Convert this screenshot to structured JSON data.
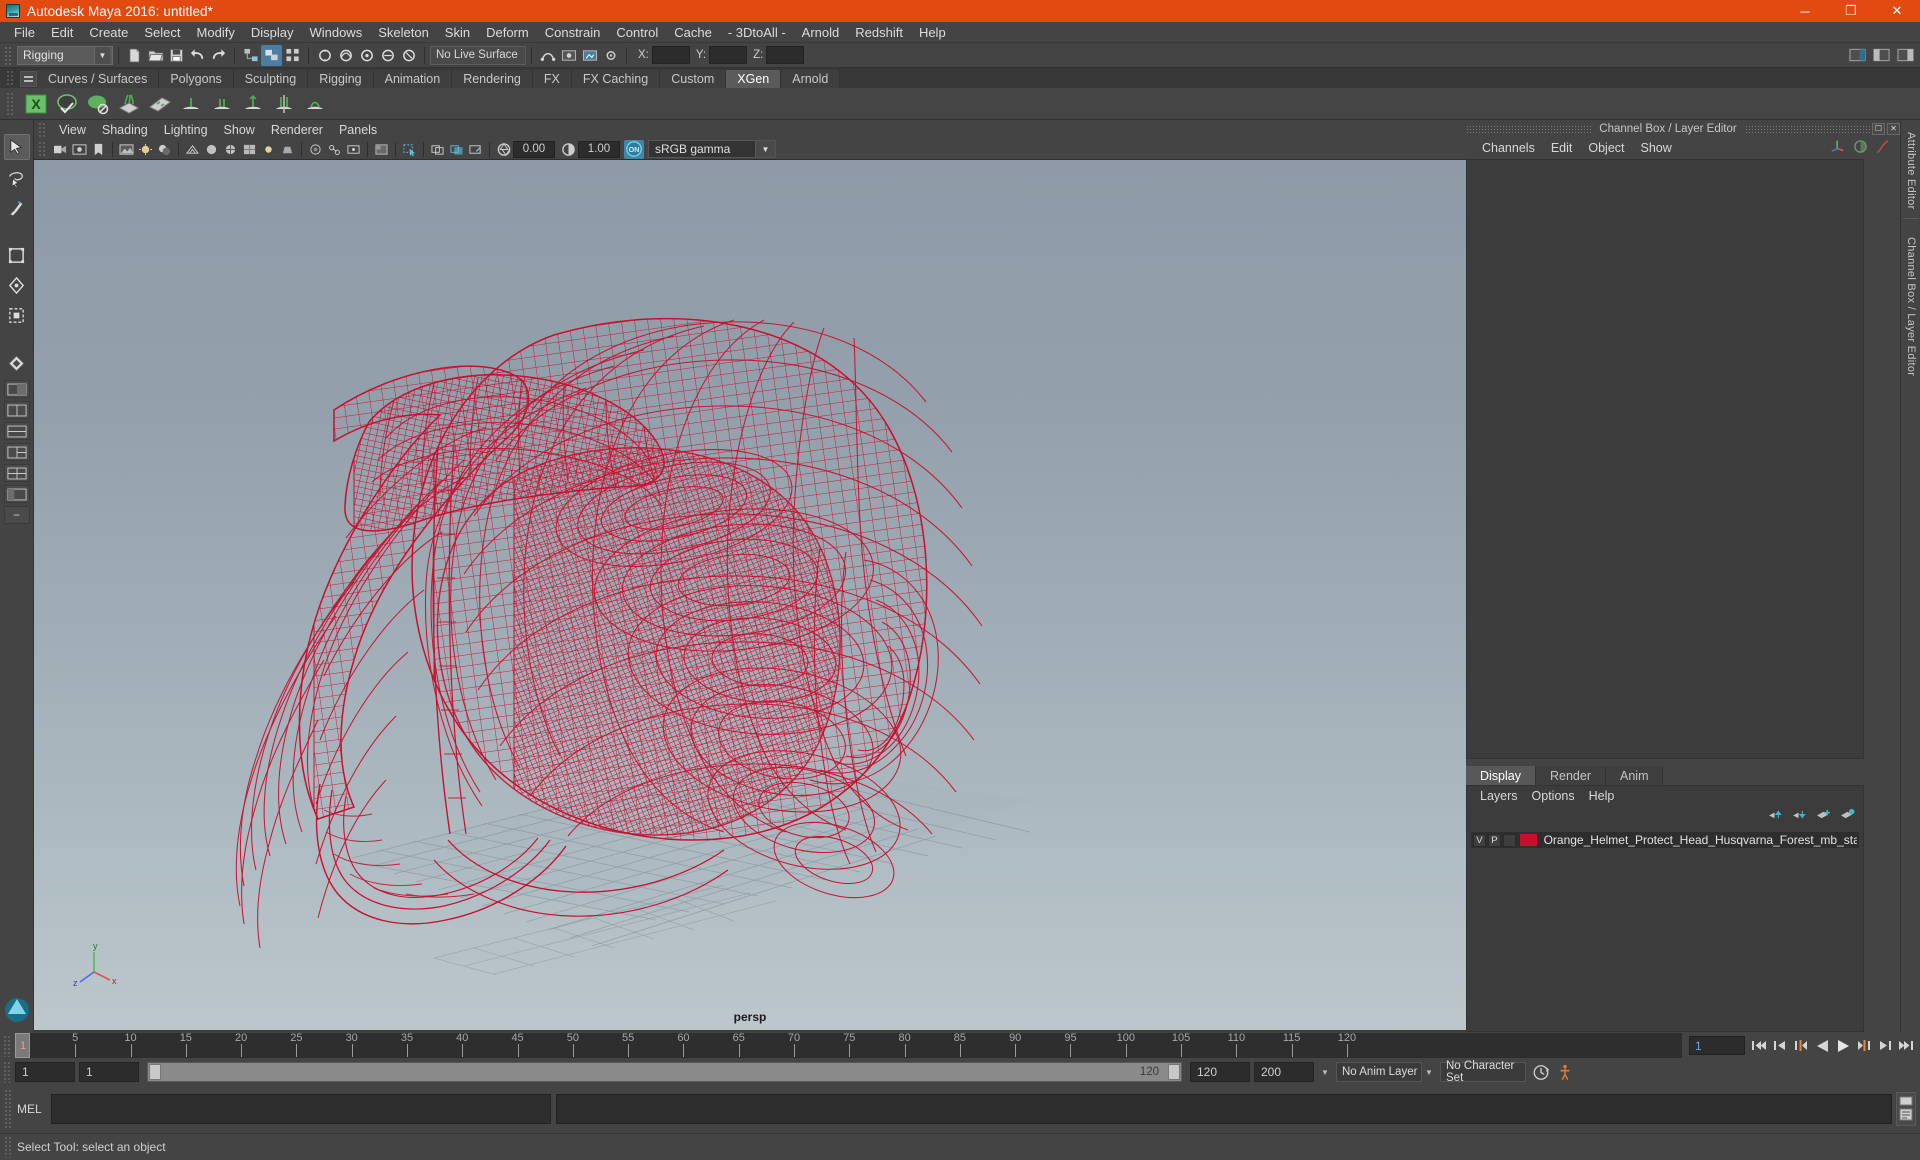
{
  "window": {
    "title": "Autodesk Maya 2016: untitled*",
    "app_icon": "maya-logo-icon",
    "buttons": {
      "minimize": "─",
      "maximize": "❐",
      "close": "✕"
    },
    "titlebar_color": "#e24a12"
  },
  "menubar": [
    "File",
    "Edit",
    "Create",
    "Select",
    "Modify",
    "Display",
    "Windows",
    "Skeleton",
    "Skin",
    "Deform",
    "Constrain",
    "Control",
    "Cache",
    "- 3DtoAll -",
    "Arnold",
    "Redshift",
    "Help"
  ],
  "statusline": {
    "menu_set": "Rigging",
    "live_surface": "No Live Surface",
    "axis": {
      "x_label": "X:",
      "x_value": "",
      "y_label": "Y:",
      "y_value": "",
      "z_label": "Z:",
      "z_value": ""
    }
  },
  "shelf": {
    "tabs": [
      "Curves / Surfaces",
      "Polygons",
      "Sculpting",
      "Rigging",
      "Animation",
      "Rendering",
      "FX",
      "FX Caching",
      "Custom",
      "XGen",
      "Arnold"
    ],
    "active_tab": "XGen"
  },
  "toolbox": {
    "tools": [
      "select-tool",
      "lasso-select-tool",
      "paint-select-tool",
      "move-tool",
      "rotate-tool",
      "scale-tool",
      "last-tool"
    ],
    "active_tool": "select-tool"
  },
  "viewport": {
    "menus": [
      "View",
      "Shading",
      "Lighting",
      "Show",
      "Renderer",
      "Panels"
    ],
    "exposure_value": "0.00",
    "gamma_value": "1.00",
    "color_management": "sRGB gamma",
    "camera_label": "persp",
    "gate_toggle": "ON",
    "model_color": "#c8102e",
    "background_top": "#8d9ba8",
    "background_bottom": "#b6c2c8"
  },
  "channel_box": {
    "panel_title": "Channel Box / Layer Editor",
    "menus": [
      "Channels",
      "Edit",
      "Object",
      "Show"
    ]
  },
  "layer_editor": {
    "tabs": [
      "Display",
      "Render",
      "Anim"
    ],
    "active_tab": "Display",
    "menus": [
      "Layers",
      "Options",
      "Help"
    ],
    "layers": [
      {
        "visibility": "V",
        "playback": "P",
        "type": "",
        "color": "#c8102e",
        "name": "Orange_Helmet_Protect_Head_Husqvarna_Forest_mb_sta"
      }
    ]
  },
  "attribute_editor": {
    "labels": [
      "Attribute Editor",
      "Channel Box / Layer Editor"
    ]
  },
  "timeline": {
    "ticks": [
      5,
      10,
      15,
      20,
      25,
      30,
      35,
      40,
      45,
      50,
      55,
      60,
      65,
      70,
      75,
      80,
      85,
      90,
      95,
      100,
      105,
      110,
      115,
      120
    ],
    "current_frame": "1",
    "current_frame_field": "1",
    "start": 1,
    "end": 120,
    "playback_buttons": [
      "go-to-start-icon",
      "step-back-key-icon",
      "step-back-frame-icon",
      "play-backwards-icon",
      "play-forwards-icon",
      "step-forward-frame-icon",
      "step-forward-key-icon",
      "go-to-end-icon"
    ]
  },
  "range_slider": {
    "anim_start": "1",
    "range_start": "1",
    "bar_start_label": "1",
    "bar_end_label": "120",
    "range_end": "120",
    "anim_end": "200",
    "anim_layer": "No Anim Layer",
    "character_set": "No Character Set",
    "auto_key": "auto-keyframe-icon",
    "anim_prefs": "animation-preferences-icon"
  },
  "command_line": {
    "language_label": "MEL",
    "input_value": "",
    "output_value": "",
    "script_editor_icon": "script-editor-icon"
  },
  "help_line": {
    "message": "Select Tool: select an object"
  }
}
